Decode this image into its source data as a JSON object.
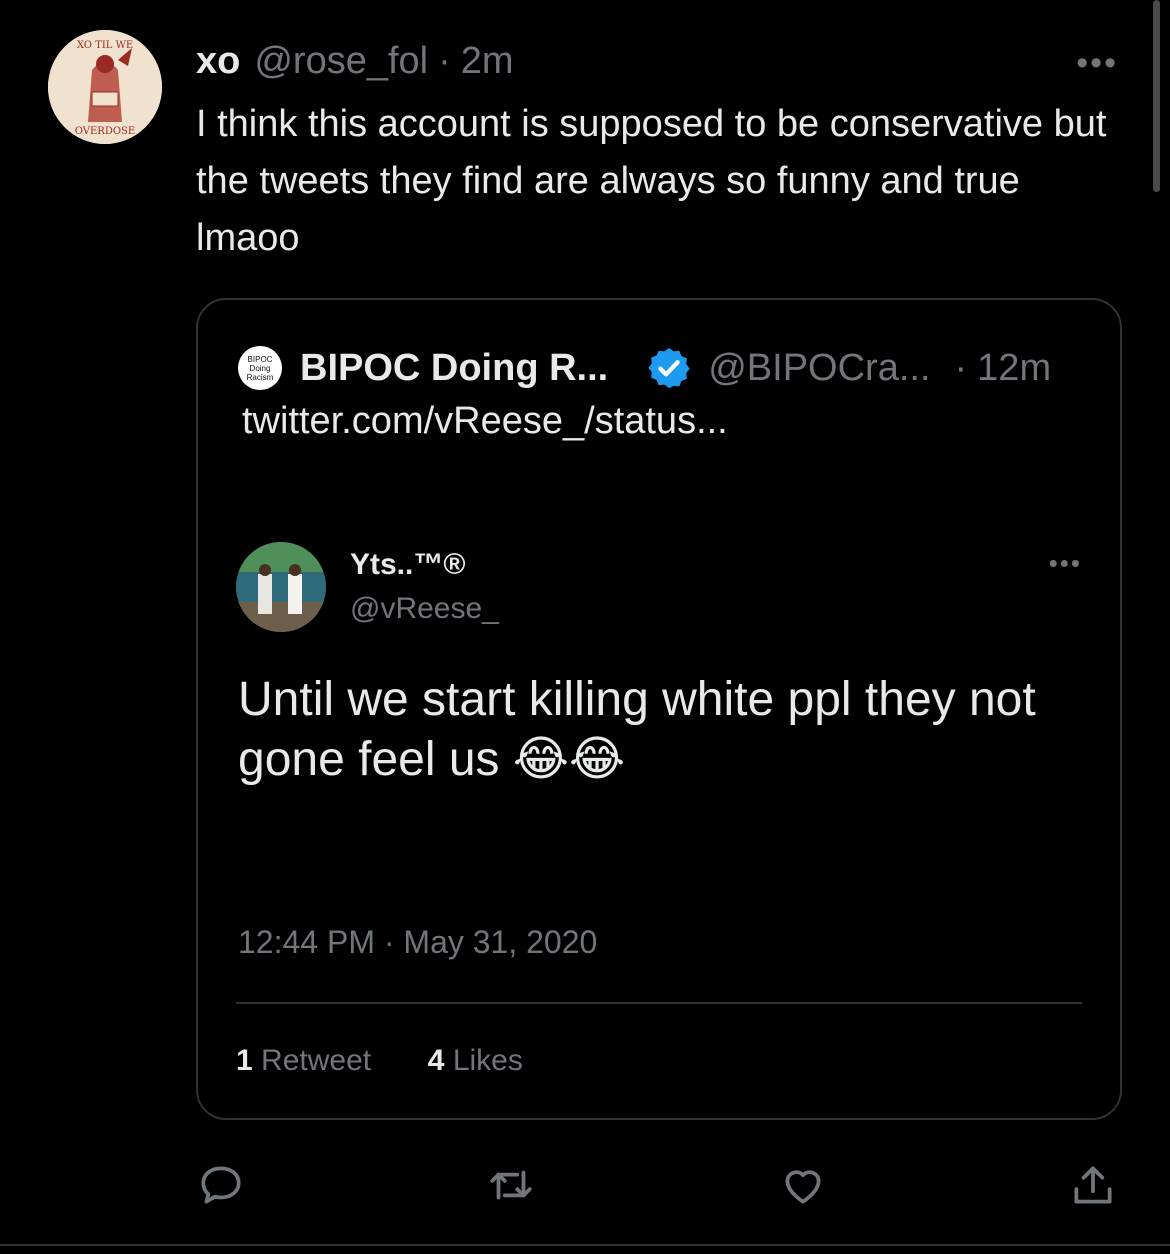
{
  "tweet": {
    "name": "xo",
    "handle": "@rose_fol",
    "separator": "·",
    "time": "2m",
    "text": "I think this account is supposed to be conservative but the tweets they find are always so funny and true lmaoo",
    "avatar_text": {
      "top": "XO TIL WE",
      "bottom": "OVERDOSE"
    },
    "more_label": "•••"
  },
  "quote": {
    "avatar_lines": [
      "BIPOC",
      "Doing",
      "Racism"
    ],
    "name": "BIPOC Doing R...",
    "handle": "@BIPOCra...",
    "separator": "·",
    "time": "12m",
    "link": "twitter.com/vReese_/status..."
  },
  "embedded": {
    "name": "Yts..™®",
    "handle": "@vReese_",
    "more_label": "•••",
    "text": "Until we start killing white ppl they not gone feel us 😂😂",
    "datetime": "12:44 PM · May 31, 2020",
    "retweets_count": "1",
    "retweets_label": "Retweet",
    "likes_count": "4",
    "likes_label": "Likes"
  },
  "colors": {
    "background": "#000000",
    "text_primary": "#e7e9ea",
    "text_secondary": "#71767b",
    "border": "#2f3336",
    "verified": "#1d9bf0"
  },
  "icons": {
    "actions": [
      "reply-icon",
      "retweet-icon",
      "like-icon",
      "share-icon"
    ],
    "embedded_actions": [
      "reply-icon",
      "retweet-icon",
      "like-icon",
      "bookmark-icon",
      "share-icon"
    ]
  }
}
